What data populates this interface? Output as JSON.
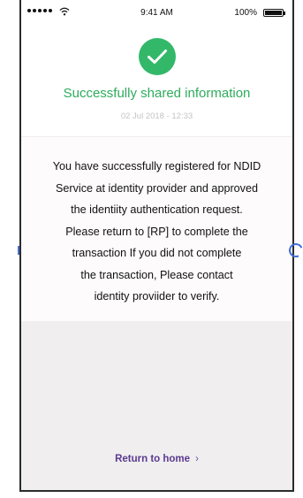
{
  "status_bar": {
    "time": "9:41 AM",
    "battery": "100%"
  },
  "header": {
    "title": "Successfully shared information",
    "timestamp": "02 Jul 2018 - 12:33",
    "icon": "check-icon"
  },
  "message": "You have successfully registered for NDID\nService at identity provider and approved\nthe identiity authentication request.\nPlease return to [RP] to complete the\ntransaction If you did not complete\nthe transaction, Please contact\nidentity proviider to verify.",
  "footer": {
    "return_label": "Return to home",
    "chevron": "›"
  },
  "colors": {
    "success": "#33b86a",
    "link": "#5b3a91"
  }
}
